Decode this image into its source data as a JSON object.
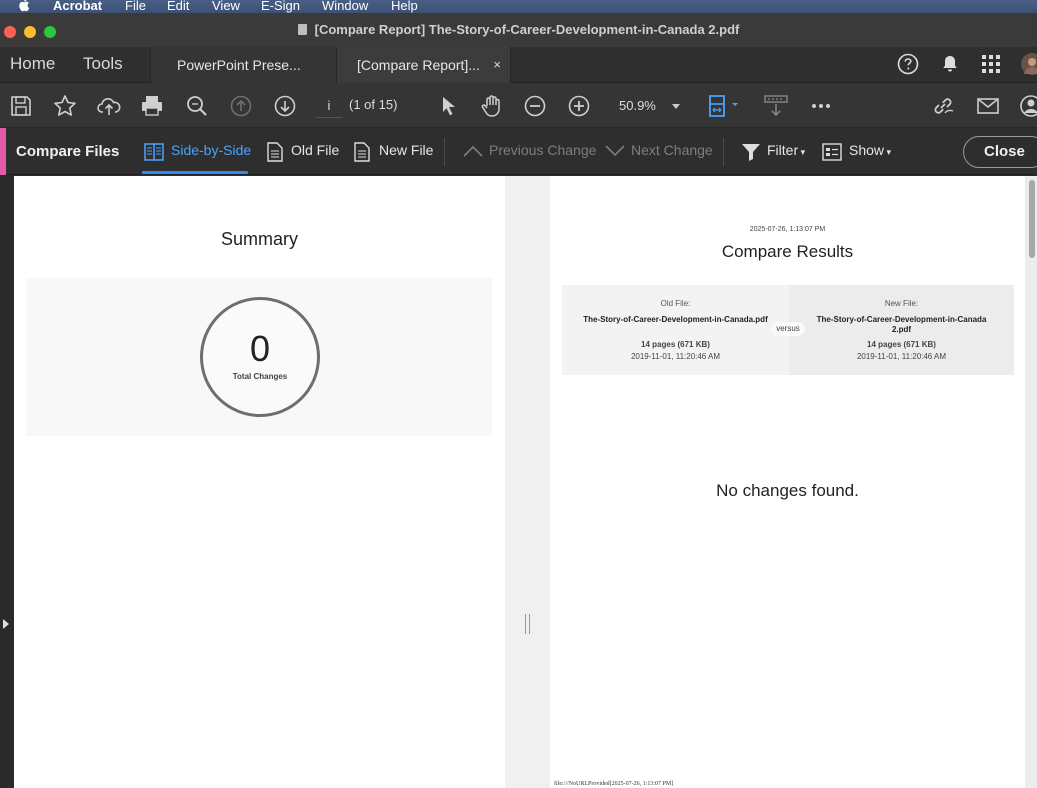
{
  "menubar": {
    "app": "Acrobat",
    "items": [
      "File",
      "Edit",
      "View",
      "E-Sign",
      "Window",
      "Help"
    ]
  },
  "window": {
    "title": "[Compare Report] The-Story-of-Career-Development-in-Canada 2.pdf"
  },
  "tabs": {
    "home": "Home",
    "tools": "Tools",
    "docs": [
      {
        "label": "PowerPoint Prese..."
      },
      {
        "label": "[Compare Report]...",
        "close": "×"
      }
    ]
  },
  "toolbar": {
    "page_input": "i",
    "page_count": "(1 of 15)",
    "zoom": "50.9%"
  },
  "compare_toolbar": {
    "title": "Compare Files",
    "side_by_side": "Side-by-Side",
    "old_file": "Old File",
    "new_file": "New File",
    "previous_change": "Previous Change",
    "next_change": "Next Change",
    "filter": "Filter",
    "show": "Show",
    "close": "Close"
  },
  "summary": {
    "title": "Summary",
    "total": "0",
    "total_label": "Total Changes"
  },
  "report": {
    "date": "2025-07-26, 1:13:07 PM",
    "title": "Compare Results",
    "old": {
      "heading": "Old File:",
      "name": "The-Story-of-Career-Development-in-Canada.pdf",
      "pages": "14 pages (671 KB)",
      "date": "2019-11-01, 11:20:46 AM"
    },
    "versus": "versus",
    "new": {
      "heading": "New File:",
      "name": "The-Story-of-Career-Development-in-Canada 2.pdf",
      "pages": "14 pages (671 KB)",
      "date": "2019-11-01, 11:20:46 AM"
    },
    "no_changes": "No changes found.",
    "footer": "file:///NoURLProvided[2025-07-26, 1:13:07 PM]"
  },
  "colors": {
    "accent": "#4aa3ff",
    "compare_marker": "#e55aa8"
  }
}
